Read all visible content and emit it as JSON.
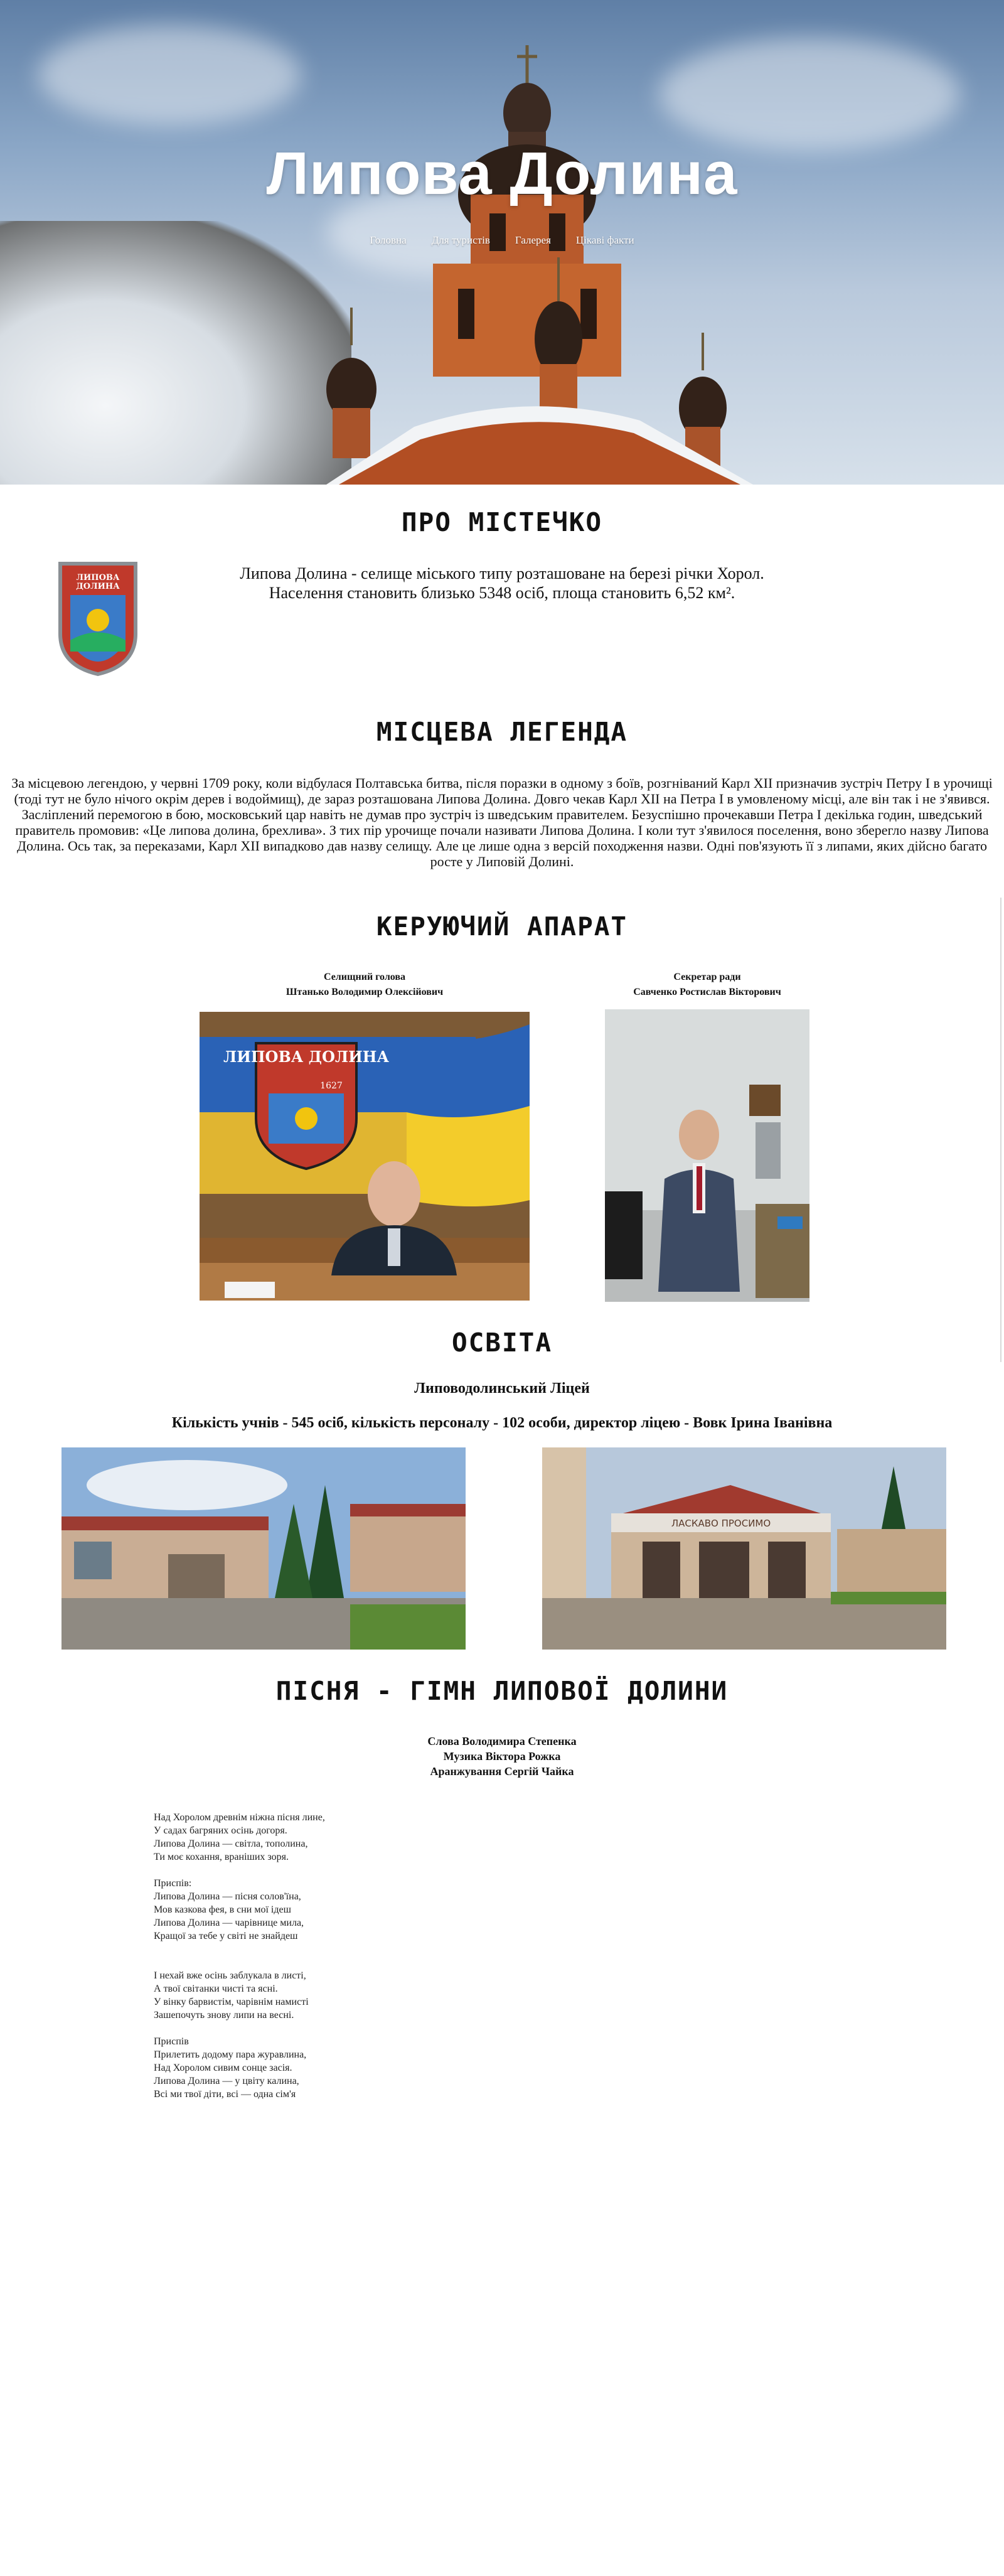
{
  "hero": {
    "title": "Липова Долина",
    "nav": [
      "Головна",
      "Для туристів",
      "Галерея",
      "Цікаві факти"
    ]
  },
  "about": {
    "heading": "ПРО МІСТЕЧКО",
    "line1": "Липова Долина - селище міського типу розташоване на березі річки Хорол.",
    "line2": "Населення становить близько 5348 осіб, площа становить 6,52 км².",
    "emblem_text": "ЛИПОВА ДОЛИНА"
  },
  "legend": {
    "heading": "МІСЦЕВА ЛЕГЕНДА",
    "text": "За місцевою легендою, у червні 1709 року, коли відбулася Полтавська битва, після поразки в одному з боїв, розгніваний Карл XII призначив зустріч Петру I в урочищі (тоді тут не було нічого окрім дерев і водоймищ), де зараз розташована Липова Долина. Довго чекав Карл XII на Петра I в умовленому місці, але він так і не з'явився. Засліплений перемогою в бою, московський цар навіть не думав про зустріч із шведським правителем. Безуспішно прочекавши Петра I декілька годин, шведський правитель промовив: «Це липова долина, брехлива». З тих пір урочище почали називати Липова Долина. І коли тут з'явилося поселення, воно зберегло назву Липова Долина. Ось так, за переказами, Карл XII випадково дав назву селищу. Але це лише одна з версій походження назви. Одні пов'язують її з липами, яких дійсно багато росте у Липовій Долині."
  },
  "government": {
    "heading": "КЕРУЮЧИЙ АПАРАТ",
    "people": [
      {
        "role": "Селищний голова",
        "name": "Штанько Володимир Олексійович"
      },
      {
        "role": "Секретар ради",
        "name": "Савченко Ростислав Вікторович"
      }
    ],
    "banner_text": "ЛИПОВА ДОЛИНА",
    "banner_year": "1627"
  },
  "education": {
    "heading": "ОСВІТА",
    "school": "Липоводолинський Ліцей",
    "stats": "Кількість учнів - 545 осіб, кількість персоналу - 102 особи, директор ліцею - Вовк Ірина Іванівна",
    "sign": "ЛАСКАВО ПРОСИМО"
  },
  "anthem": {
    "heading": "ПІСНЯ - ГІМН ЛИПОВОЇ ДОЛИНИ",
    "credits": [
      "Слова Володимира Степенка",
      "Музика Віктора Рожка",
      "Аранжування Сергій Чайка"
    ],
    "stanzas": [
      [
        "Над Хоролом древнім ніжна пісня лине,",
        "У садах багряних осінь догоря.",
        "Липова Долина — світла, тополина,",
        "Ти моє кохання, враніших зоря."
      ],
      [
        "Приспів:",
        "Липова Долина — пісня солов'їна,",
        "Мов казкова фея, в сни мої ідеш",
        "Липова Долина — чарівнице мила,",
        "Кращої за тебе у світі не знайдеш"
      ],
      [
        "І нехай вже осінь заблукала в листі,",
        "А твої світанки чисті та ясні.",
        "У вінку барвистім, чарівнім намисті",
        "Зашепочуть знову липи на весні."
      ],
      [
        "Приспів",
        "Прилетить додому пара журавлина,",
        "Над Хоролом сивим сонце засія.",
        "Липова Долина — у цвіту калина,",
        "Всі ми твої діти, всі — одна сім'я"
      ]
    ]
  }
}
